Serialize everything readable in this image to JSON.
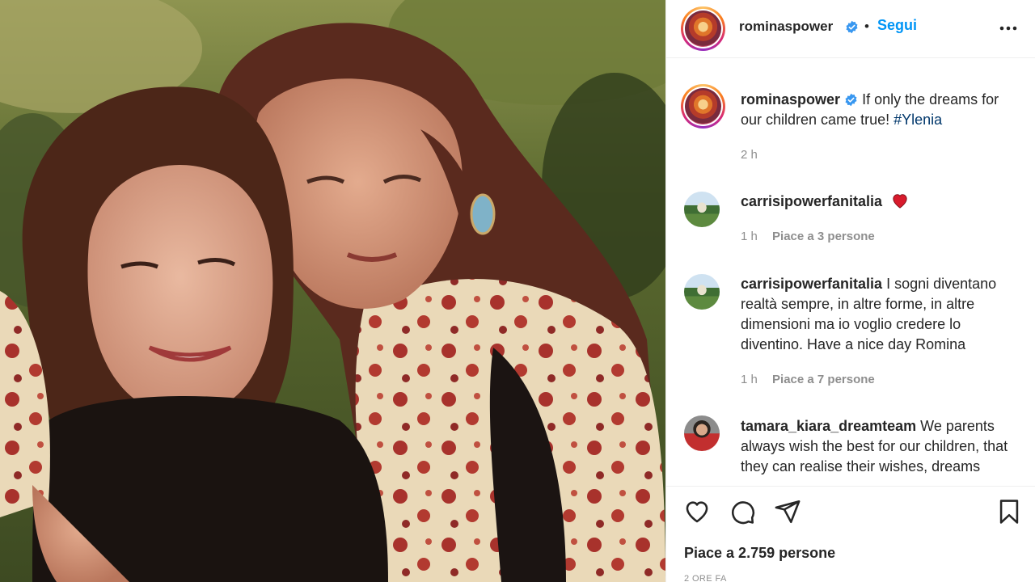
{
  "post": {
    "author": "rominaspower",
    "follow_label": "Segui",
    "separator": "•",
    "verified_icon": "verified-badge-icon",
    "more_icon": "more-options-icon"
  },
  "caption": {
    "username": "rominaspower",
    "text": "If only the dreams for our children came true!",
    "hashtag": "#Ylenia",
    "time": "2 h"
  },
  "comments": [
    {
      "username": "carrisipowerfanitalia",
      "text": "",
      "emoji": "heart",
      "time": "1 h",
      "likes": "Piace a 3 persone"
    },
    {
      "username": "carrisipowerfanitalia",
      "text": "I sogni diventano realtà sempre, in altre forme, in altre dimensioni ma io voglio credere lo diventino. Have a nice day Romina",
      "time": "1 h",
      "likes": "Piace a 7 persone"
    },
    {
      "username": "tamara_kiara_dreamteam",
      "text": "We parents always wish the best for our children, that they can realise their wishes, dreams"
    }
  ],
  "actions": {
    "likes_count": "Piace a 2.759 persone",
    "time_ago": "2 ORE FA",
    "icons": [
      "like-icon",
      "comment-icon",
      "share-icon",
      "save-icon"
    ]
  },
  "colors": {
    "accent": "#0095f6",
    "text": "#262626",
    "muted": "#8e8e8e",
    "hashtag": "#00376b",
    "heart": "#ed4956"
  }
}
